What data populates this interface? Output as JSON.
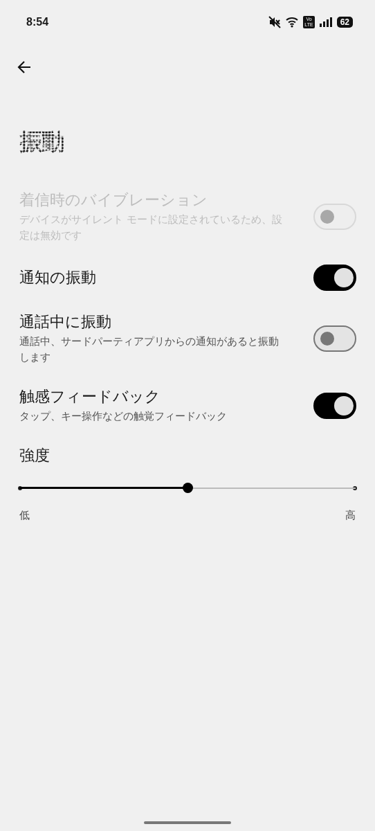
{
  "status_bar": {
    "time": "8:54",
    "volte": [
      "Vo",
      "LTE"
    ],
    "battery": "62"
  },
  "title": "振動",
  "settings": [
    {
      "title": "着信時のバイブレーション",
      "subtitle": "デバイスがサイレント モードに設定されているため、設定は無効です",
      "on": false,
      "disabled": true
    },
    {
      "title": "通知の振動",
      "on": true,
      "disabled": false
    },
    {
      "title": "通話中に振動",
      "subtitle": "通話中、サードパーティアプリからの通知があると振動します",
      "on": false,
      "disabled": false
    },
    {
      "title": "触感フィードバック",
      "subtitle": "タップ、キー操作などの触覚フィードバック",
      "on": true,
      "disabled": false
    }
  ],
  "intensity": {
    "label": "強度",
    "level": 0.5,
    "min_label": "低",
    "max_label": "高"
  }
}
